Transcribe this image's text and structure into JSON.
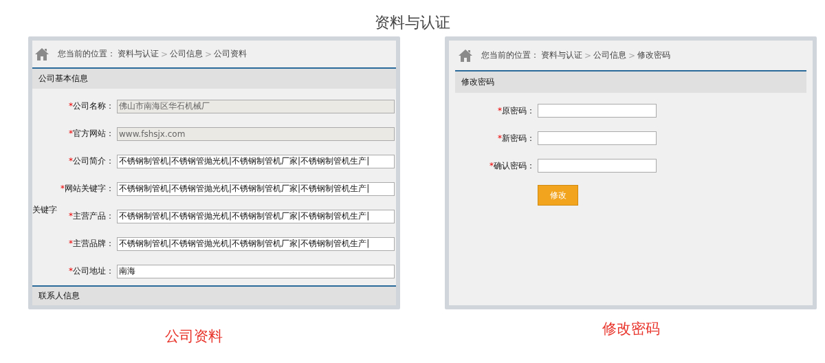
{
  "page_title": "资料与认证",
  "panels": [
    {
      "kind": "company",
      "breadcrumb_prefix": "您当前的位置：",
      "breadcrumb": [
        {
          "kind": "link",
          "text": "资料与认证"
        },
        {
          "kind": "separator",
          "text": ">"
        },
        {
          "kind": "link",
          "text": "公司信息"
        },
        {
          "kind": "separator",
          "text": ">"
        },
        {
          "kind": "link",
          "text": "公司资料"
        }
      ],
      "section": "公司基本信息",
      "fields": [
        {
          "required_mark": "*",
          "label": "公司名称：",
          "value": "佛山市南海区华石机械厂",
          "disabled": true
        },
        {
          "required_mark": "*",
          "label": "官方网站：",
          "value": "www.fshsjx.com",
          "disabled": true
        },
        {
          "required_mark": "*",
          "label": "公司简介：",
          "value": "不锈钢制管机|不锈钢管抛光机|不锈钢制管机厂家|不锈钢制管机生产|",
          "disabled": false
        },
        {
          "required_mark": "*",
          "label": "网站关键字：",
          "value": "不锈钢制管机|不锈钢管抛光机|不锈钢制管机厂家|不锈钢制管机生产|",
          "disabled": false
        },
        {
          "required_mark": "*",
          "label": "主营产品：",
          "value": "不锈钢制管机|不锈钢管抛光机|不锈钢制管机厂家|不锈钢制管机生产|",
          "disabled": false
        },
        {
          "required_mark": "*",
          "label": "主营品牌：",
          "value": "不锈钢制管机|不锈钢管抛光机|不锈钢制管机厂家|不锈钢制管机生产|",
          "disabled": false
        },
        {
          "required_mark": "*",
          "label": "公司地址：",
          "value": "南海",
          "disabled": false
        }
      ],
      "stray_label": "关键字",
      "footer_section": "联系人信息",
      "caption": "公司资料"
    },
    {
      "kind": "password",
      "breadcrumb_prefix": "您当前的位置：",
      "breadcrumb": [
        {
          "kind": "link",
          "text": "资料与认证"
        },
        {
          "kind": "separator",
          "text": ">"
        },
        {
          "kind": "link",
          "text": "公司信息"
        },
        {
          "kind": "separator",
          "text": ">"
        },
        {
          "kind": "link",
          "text": "修改密码"
        }
      ],
      "section": "修改密码",
      "fields": [
        {
          "required_mark": "*",
          "label": "原密码：",
          "disabled": false
        },
        {
          "required_mark": "*",
          "label": "新密码：",
          "disabled": false
        },
        {
          "required_mark": "*",
          "label": "确认密码：",
          "disabled": false
        }
      ],
      "button": "修改",
      "caption": "修改密码"
    }
  ]
}
